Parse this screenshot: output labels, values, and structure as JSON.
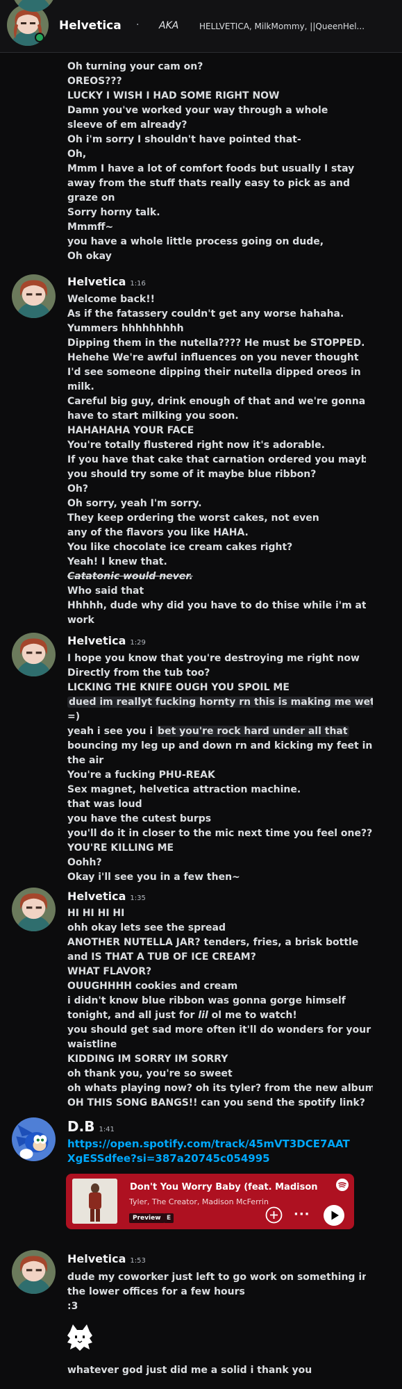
{
  "header": {
    "name": "Helvetica",
    "separator": "·",
    "aka_label": "AKA",
    "aliases": "HELLVETICA, MilkMommy, ||QueenHel..."
  },
  "messages": [
    {
      "author": "",
      "time": "",
      "lines": [
        "Oh turning your cam on?",
        "OREOS???",
        "LUCKY I WISH I HAD SOME RIGHT NOW",
        "Damn you've worked your way through a whole",
        "sleeve of em already?",
        "Oh i'm sorry I shouldn't have pointed that-",
        "Oh,",
        "Mmm I have a lot of comfort foods but usually I stay",
        "away from the stuff thats really easy to pick as and",
        "graze on",
        "Sorry horny talk.",
        "Mmmff~",
        "you have a whole little process going on dude,",
        "Oh okay"
      ]
    },
    {
      "author": "Helvetica",
      "time": "1:16",
      "lines": [
        "Welcome back!!",
        "As if the fatassery couldn't get any worse hahaha.",
        "Yummers hhhhhhhhh",
        "Dipping them in the nutella???? He must be STOPPED.",
        "Hehehe We're awful influences on you never thought",
        "I'd see someone dipping their nutella dipped oreos in",
        "milk.",
        "Careful big guy, drink enough of that and we're gonna",
        "have to start milking you soon.",
        "HAHAHAHA YOUR FACE",
        "You're totally flustered right now it's adorable.",
        "If you have that cake that carnation ordered you maybe",
        "you should try some of it maybe blue ribbon?",
        "Oh?",
        "Oh sorry, yeah I'm sorry.",
        "They keep ordering the worst cakes, not even",
        "any of the flavors you like HAHA.",
        "You like chocolate ice cream cakes right?",
        "Yeah! I knew that.",
        "Catatonic would never.",
        "Who said that",
        "Hhhhh, dude why did you have to do thise while i'm at",
        "work"
      ]
    },
    {
      "author": "Helvetica",
      "time": "1:29",
      "lines": [
        "I hope you know that you're destroying me right now",
        "Directly from the tub too?",
        "LICKING THE KNIFE OUGH YOU SPOIL ME",
        "dued im  reallyt fucking hornty rn this is making me wet",
        "=)",
        "yeah i see you i ",
        "bet you're rock hard under all that",
        "bouncing my leg up and down rn and kicking my feet in",
        "the air",
        "You're a fucking PHU-REAK",
        "Sex magnet, helvetica attraction machine.",
        "that was loud",
        "you have the cutest burps",
        "you'll do it in closer to the mic next time you feel one??",
        "YOU'RE KILLING ME",
        "Oohh?",
        "Okay i'll see you in a few then~"
      ]
    },
    {
      "author": "Helvetica",
      "time": "1:35",
      "lines": [
        "HI HI HI HI",
        "ohh okay lets see the spread",
        "ANOTHER NUTELLA JAR? tenders, fries, a brisk bottle",
        "and IS THAT A TUB OF ICE CREAM?",
        "WHAT FLAVOR?",
        "OUUGHHHH cookies and cream",
        "i didn't know blue ribbon was gonna gorge himself",
        "tonight, and all just for ",
        "lil",
        " ol me to watch!",
        "you should get sad more often it'll do wonders for your",
        "waistline",
        "KIDDING IM SORRY IM SORRY",
        "oh thank you, you're so sweet",
        "oh whats playing now? oh its tyler? from the new album?",
        "OH THIS SONG BANGS!! can you send the spotify link?"
      ]
    },
    {
      "author": "D.B",
      "time": "1:41",
      "link": "https://open.spotify.com/track/45mVT3DCE7AATXgESSdfee?si=387a20745c054995",
      "embed": {
        "track": "Don't You Worry Baby (feat. Madison McFe",
        "artist": "Tyler, The Creator, Madison McFerrin",
        "preview": "Preview",
        "explicit": "E",
        "more": "···"
      }
    },
    {
      "author": "Helvetica",
      "time": "1:53",
      "lines": [
        "dude my coworker just left to go work on something in",
        "the lower offices for a few hours",
        ":3",
        "whatever god just did me a solid i thank you"
      ]
    }
  ],
  "colors": {
    "background": "#0c0c0d",
    "link": "#00a8fc",
    "spotify_embed": "#ae1121",
    "online_status": "#23a55a"
  }
}
